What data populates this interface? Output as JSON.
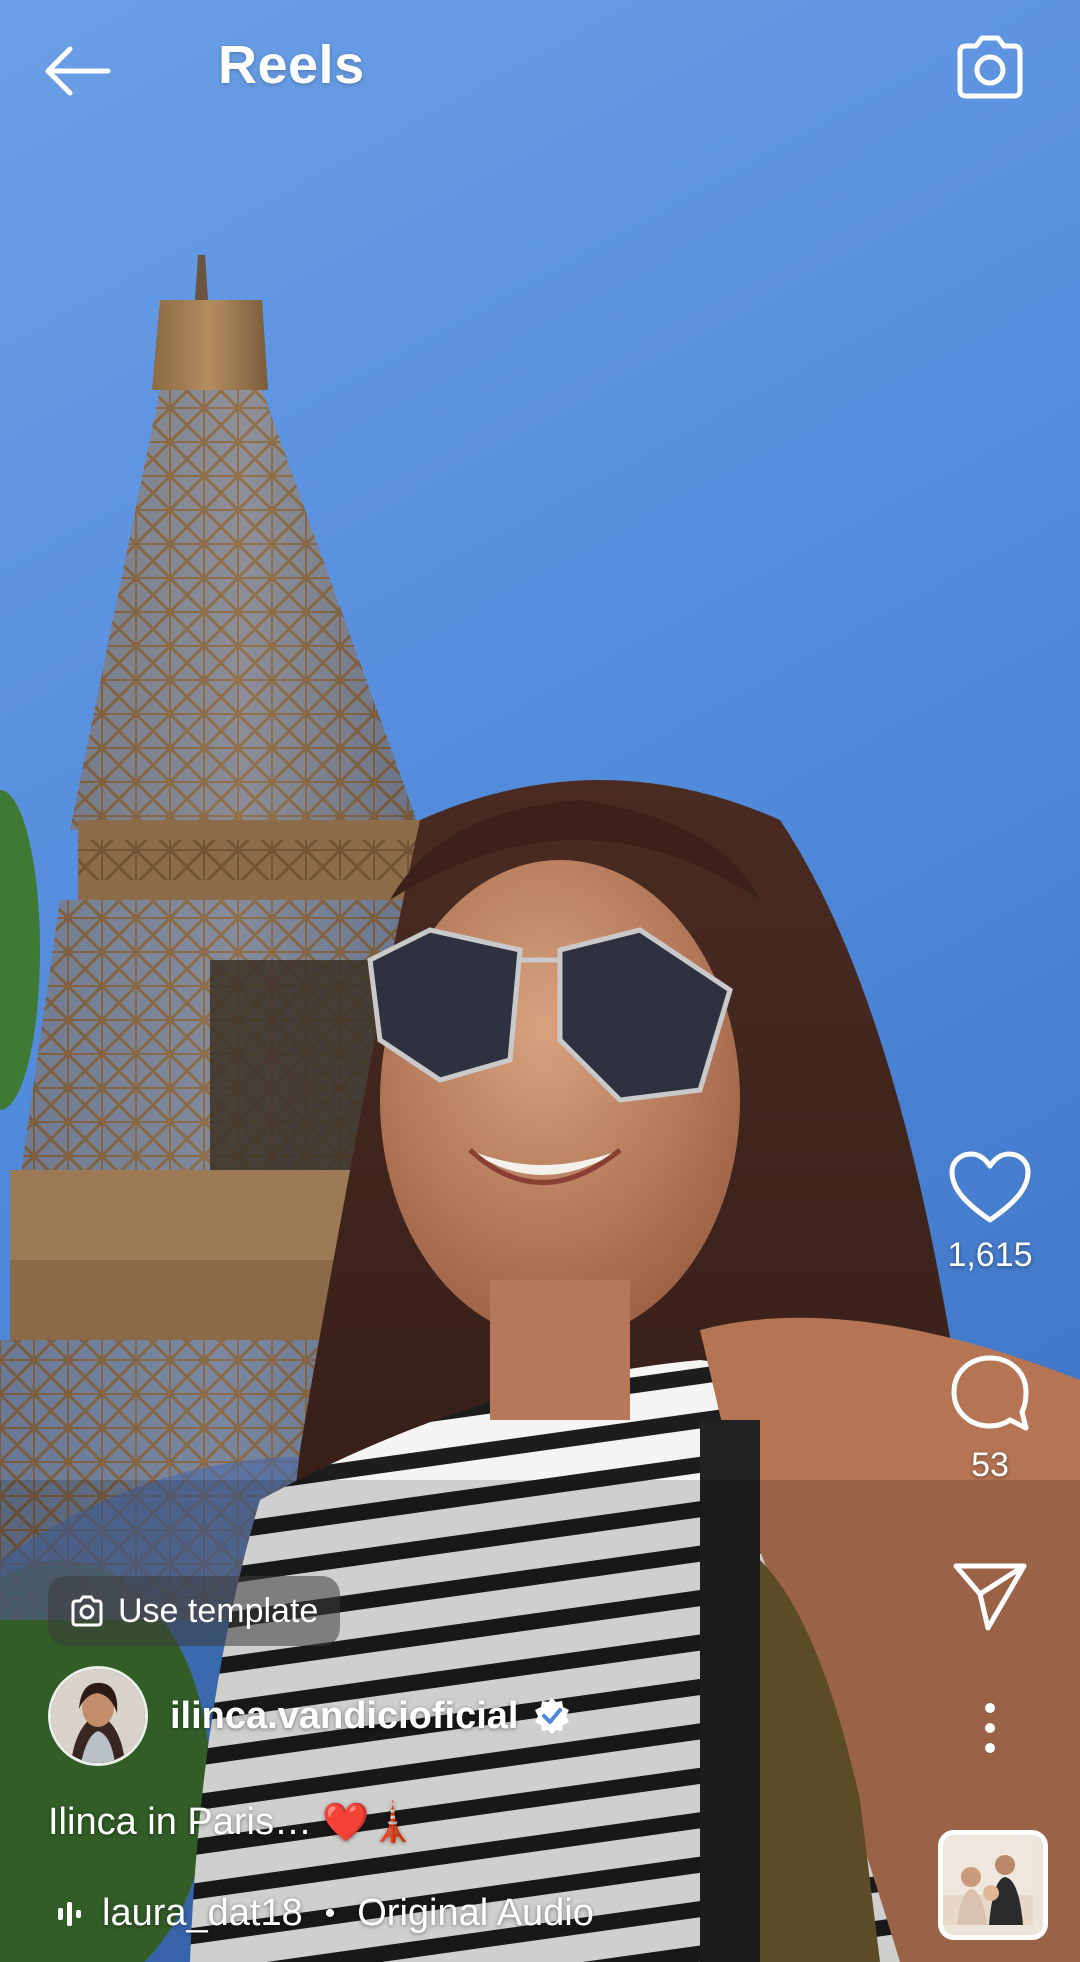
{
  "header": {
    "title": "Reels",
    "back_icon": "arrow-left-icon",
    "camera_icon": "camera-icon"
  },
  "actions": {
    "likes": "1,615",
    "comments": "53",
    "like_icon": "heart-icon",
    "comment_icon": "comment-bubble-icon",
    "share_icon": "paper-plane-icon",
    "more_icon": "more-vertical-icon"
  },
  "template": {
    "label": "Use template",
    "icon": "camera-icon"
  },
  "author": {
    "username": "ilinca.vandicioficial",
    "verified_icon": "verified-badge-icon"
  },
  "caption": {
    "text": "Ilinca in Paris…",
    "emojis": "❤️🗼"
  },
  "audio": {
    "artist": "laura_dat18",
    "separator": "•",
    "track": "Original Audio",
    "icon": "audio-bars-icon"
  },
  "colors": {
    "sky_top": "#5f93e0",
    "sky_bottom": "#4e86d8",
    "tower": "#a07d55",
    "heart_emoji": "#e0242f",
    "accent_white": "#ffffff"
  }
}
